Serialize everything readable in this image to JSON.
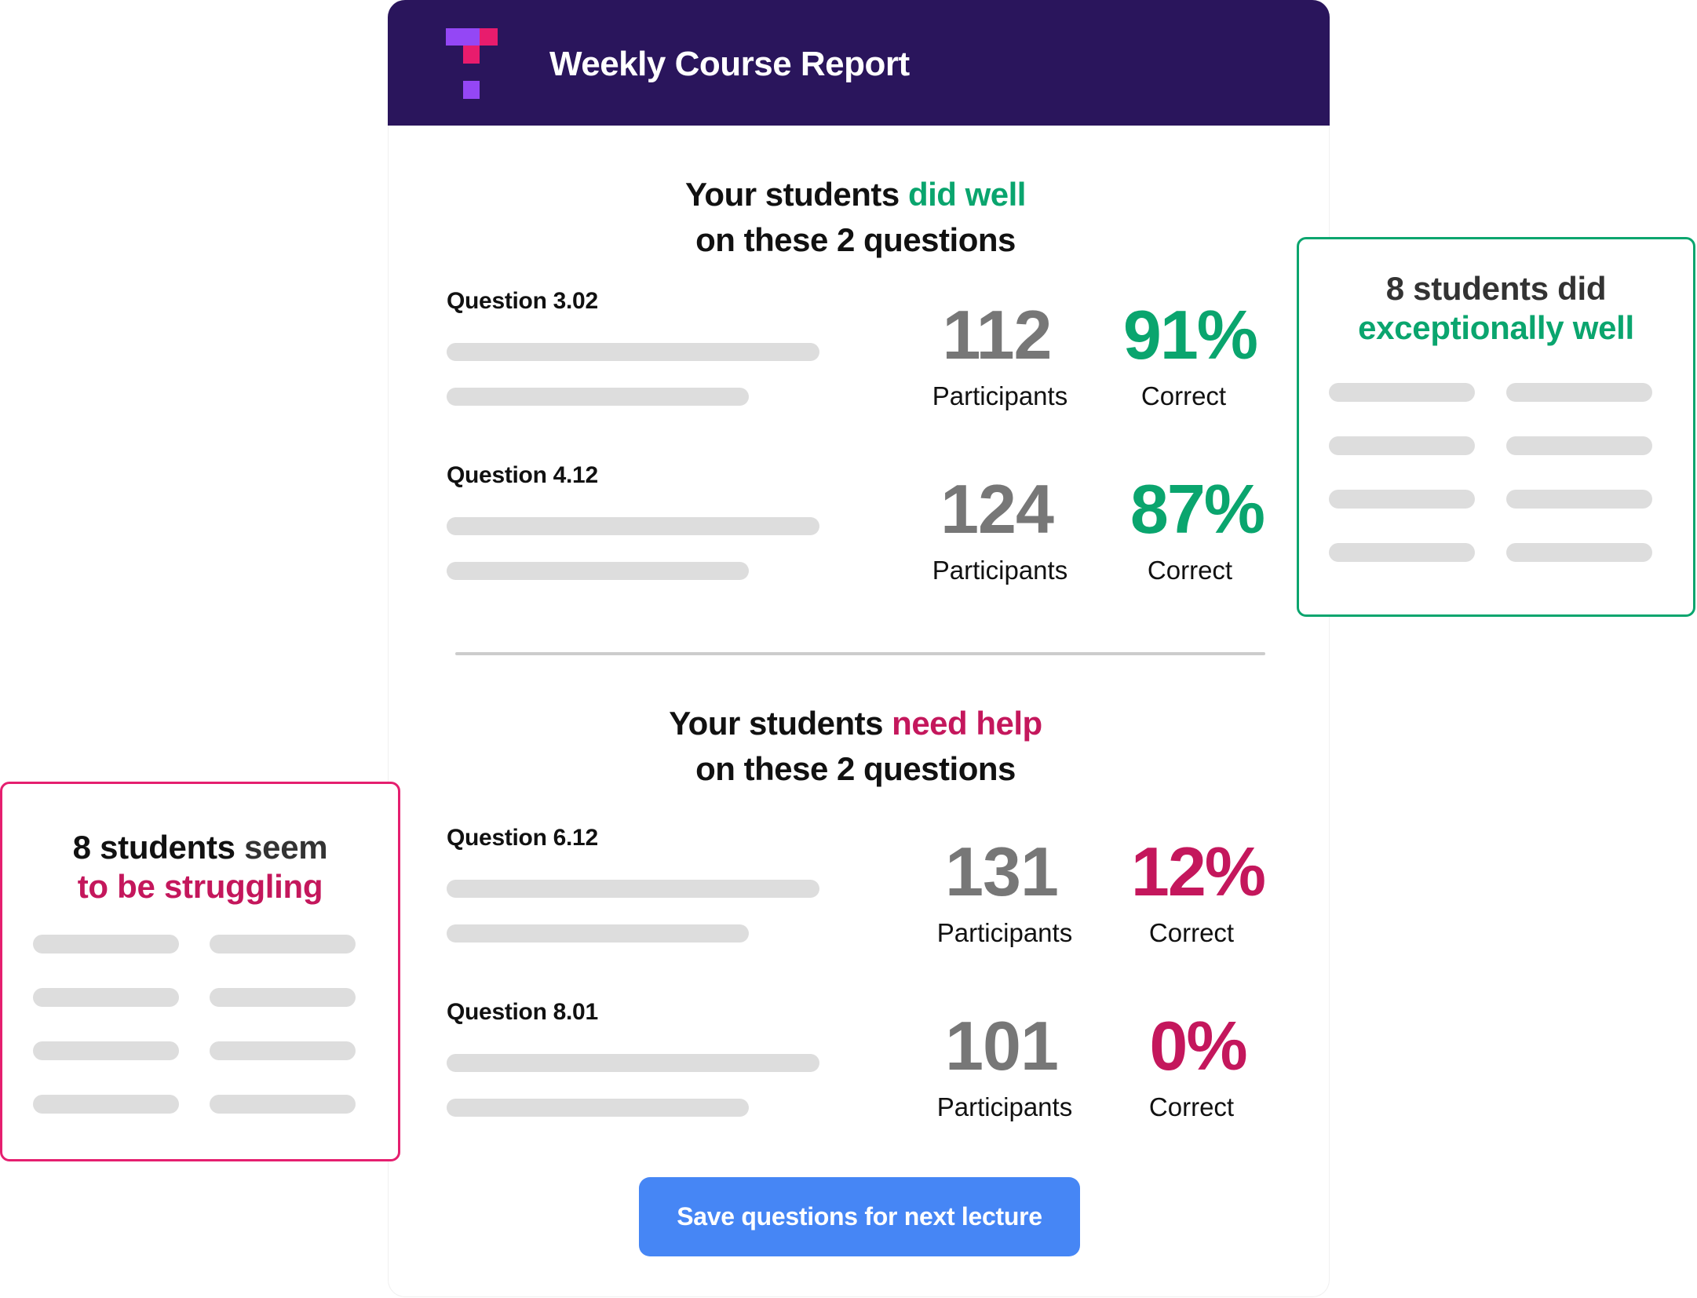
{
  "header": {
    "title": "Weekly Course Report",
    "logo_icon": "brand-t-logo-icon",
    "background_color": "#2a155c"
  },
  "colors": {
    "good": "#0aa56e",
    "bad": "#c4175c",
    "pink_border": "#e51f6f",
    "button": "#4686f5",
    "number_gray": "#777777",
    "placeholder": "#dddddd"
  },
  "did_well_section": {
    "heading_prefix": "Your students ",
    "heading_highlight": "did well",
    "heading_line2": "on these 2 questions",
    "questions": [
      {
        "label": "Question 3.02",
        "participants": "112",
        "participants_label": "Participants",
        "correct": "91%",
        "correct_label": "Correct"
      },
      {
        "label": "Question 4.12",
        "participants": "124",
        "participants_label": "Participants",
        "correct": "87%",
        "correct_label": "Correct"
      }
    ]
  },
  "need_help_section": {
    "heading_prefix": "Your students ",
    "heading_highlight": "need help",
    "heading_line2": "on these 2 questions",
    "questions": [
      {
        "label": "Question 6.12",
        "participants": "131",
        "participants_label": "Participants",
        "correct": "12%",
        "correct_label": "Correct"
      },
      {
        "label": "Question 8.01",
        "participants": "101",
        "participants_label": "Participants",
        "correct": "0%",
        "correct_label": "Correct"
      }
    ]
  },
  "exceptional_card": {
    "line1": "8 students did",
    "line2": "exceptionally well",
    "placeholder_rows": 4,
    "placeholder_cols": 2
  },
  "struggling_card": {
    "line1_strong": "8 students",
    "line1_rest": " seem",
    "line2": "to be struggling",
    "placeholder_rows": 4,
    "placeholder_cols": 2
  },
  "actions": {
    "save_label": "Save questions for next lecture"
  }
}
